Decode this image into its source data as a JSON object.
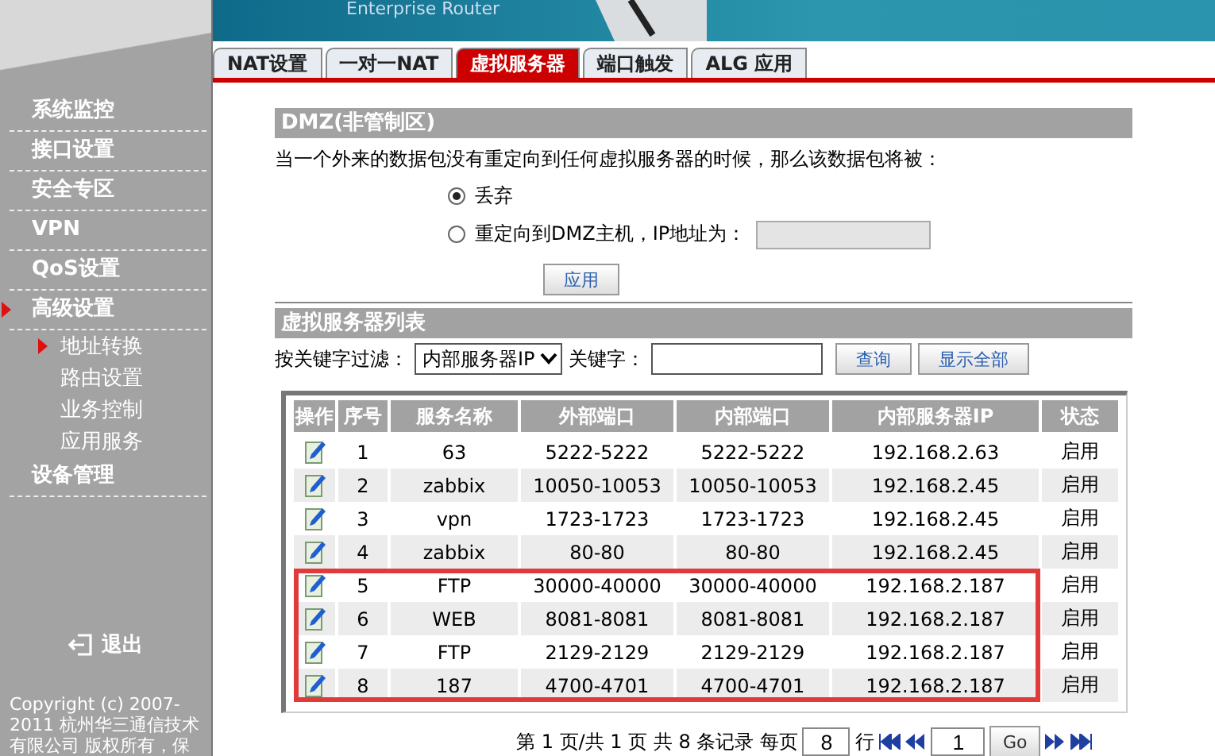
{
  "header": {
    "title": "Enterprise Router"
  },
  "sidebar": {
    "items": [
      {
        "label": "系统监控"
      },
      {
        "label": "接口设置"
      },
      {
        "label": "安全专区"
      },
      {
        "label": "VPN"
      },
      {
        "label": "QoS设置"
      },
      {
        "label": "高级设置",
        "children": [
          {
            "label": "地址转换",
            "selected": true
          },
          {
            "label": "路由设置",
            "selected": false
          },
          {
            "label": "业务控制",
            "selected": false
          },
          {
            "label": "应用服务",
            "selected": false
          }
        ]
      },
      {
        "label": "设备管理"
      }
    ],
    "logout": "退出",
    "copyright": "Copyright (c) 2007-2011 杭州华三通信技术有限公司 版权所有，保"
  },
  "tabs": [
    {
      "label": "NAT设置",
      "selected": false
    },
    {
      "label": "一对一NAT",
      "selected": false
    },
    {
      "label": "虚拟服务器",
      "selected": true
    },
    {
      "label": "端口触发",
      "selected": false
    },
    {
      "label": "ALG 应用",
      "selected": false
    }
  ],
  "dmz": {
    "title": "DMZ(非管制区)",
    "description": "当一个外来的数据包没有重定向到任何虚拟服务器的时候，那么该数据包将被：",
    "options": [
      {
        "label": "丢弃",
        "selected": true,
        "kind": "plain"
      },
      {
        "label": "重定向到DMZ主机，IP地址为：",
        "selected": false,
        "kind": "field"
      }
    ],
    "apply": "应用"
  },
  "list": {
    "title": "虚拟服务器列表",
    "filter_label": "按关键字过滤：",
    "filter_value": "内部服务器IP",
    "keyword_label": "关键字：",
    "query": "查询",
    "show_all": "显示全部",
    "columns": [
      "操作",
      "序号",
      "服务名称",
      "外部端口",
      "内部端口",
      "内部服务器IP",
      "状态"
    ],
    "rows": [
      {
        "no": "1",
        "name": "63",
        "ext": "5222-5222",
        "int": "5222-5222",
        "ip": "192.168.2.63",
        "status": "启用",
        "highlighted": false
      },
      {
        "no": "2",
        "name": "zabbix",
        "ext": "10050-10053",
        "int": "10050-10053",
        "ip": "192.168.2.45",
        "status": "启用",
        "highlighted": false
      },
      {
        "no": "3",
        "name": "vpn",
        "ext": "1723-1723",
        "int": "1723-1723",
        "ip": "192.168.2.45",
        "status": "启用",
        "highlighted": false
      },
      {
        "no": "4",
        "name": "zabbix",
        "ext": "80-80",
        "int": "80-80",
        "ip": "192.168.2.45",
        "status": "启用",
        "highlighted": false
      },
      {
        "no": "5",
        "name": "FTP",
        "ext": "30000-40000",
        "int": "30000-40000",
        "ip": "192.168.2.187",
        "status": "启用",
        "highlighted": true
      },
      {
        "no": "6",
        "name": "WEB",
        "ext": "8081-8081",
        "int": "8081-8081",
        "ip": "192.168.2.187",
        "status": "启用",
        "highlighted": true
      },
      {
        "no": "7",
        "name": "FTP",
        "ext": "2129-2129",
        "int": "2129-2129",
        "ip": "192.168.2.187",
        "status": "启用",
        "highlighted": true
      },
      {
        "no": "8",
        "name": "187",
        "ext": "4700-4701",
        "int": "4700-4701",
        "ip": "192.168.2.187",
        "status": "启用",
        "highlighted": true
      }
    ]
  },
  "pagination": {
    "summary": "第 1 页/共 1 页 共 8 条记录 每页",
    "per_page": "8",
    "rows_label": "行",
    "page": "1",
    "go": "Go"
  }
}
